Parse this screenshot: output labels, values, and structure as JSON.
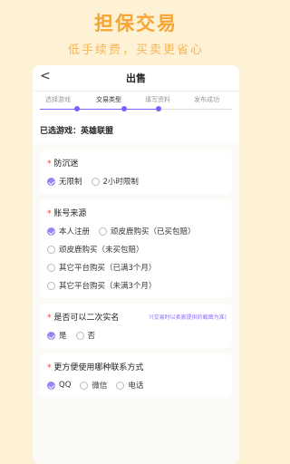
{
  "banner": {
    "title": "担保交易",
    "subtitle": "低手续费，买卖更省心"
  },
  "nav": {
    "back_glyph": "<",
    "title": "出售"
  },
  "steps": {
    "items": [
      "选择游戏",
      "交易类型",
      "填写资料",
      "发布成功"
    ],
    "active_index": 1
  },
  "selected_game": "已选游戏：英雄联盟",
  "sections": {
    "addiction": {
      "required": "*",
      "question": "防沉迷",
      "options": [
        "无限制",
        "2小时限制"
      ],
      "selected": 0
    },
    "source": {
      "required": "*",
      "question": "账号来源",
      "options": [
        "本人注册",
        "顽皮鹿购买（已买包赔）",
        "顽皮鹿购买（未买包赔）",
        "其它平台购买（已满3个月）",
        "其它平台购买（未满3个月）"
      ],
      "selected": 0
    },
    "realname": {
      "required": "*",
      "question": "是否可以二次实名",
      "hint": "?(交易时以卖家提供的截图为准)",
      "options": [
        "是",
        "否"
      ],
      "selected": 0
    },
    "contact": {
      "required": "*",
      "question": "更方便使用哪种联系方式",
      "options": [
        "QQ",
        "微信",
        "电话"
      ],
      "selected": 0
    }
  },
  "colors": {
    "accent": "#7b61ff",
    "banner_orange": "#f6a534",
    "background": "#fdf2d6"
  }
}
